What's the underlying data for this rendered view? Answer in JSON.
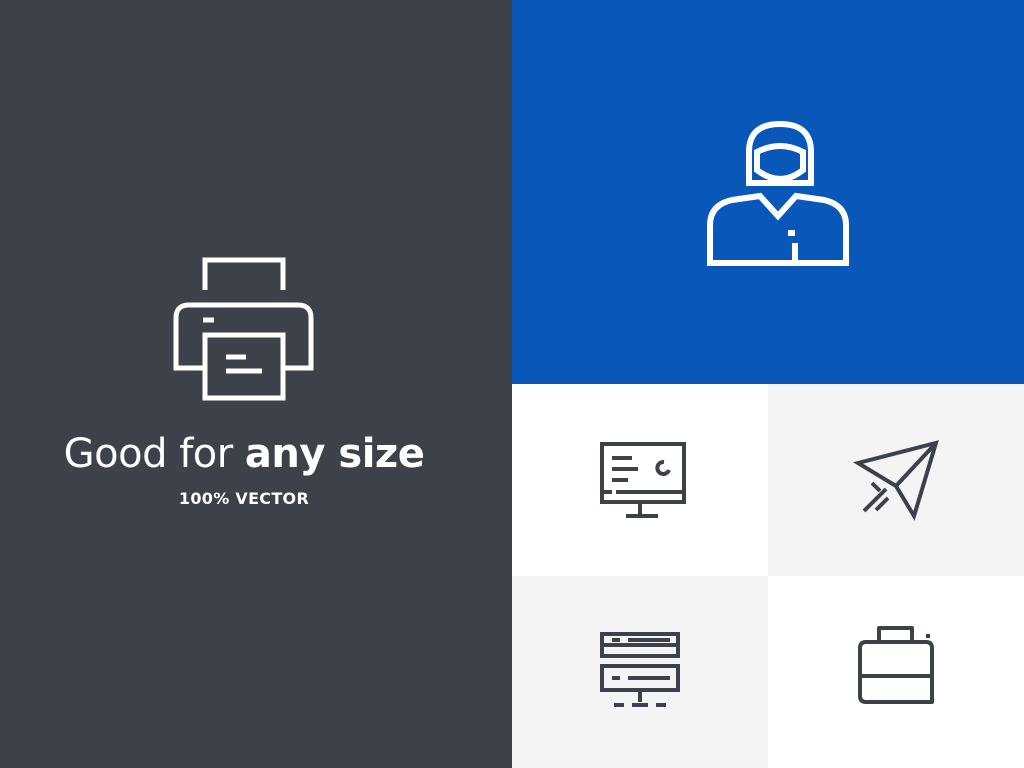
{
  "headline": {
    "regular": "Good for",
    "bold": "any size"
  },
  "subline": "100% VECTOR",
  "colors": {
    "left_panel": "#3c414a",
    "blue_panel": "#0957b9",
    "white_tile": "#ffffff",
    "light_tile": "#f4f4f4",
    "icon_dark": "#3c414a",
    "icon_light": "#ffffff"
  },
  "icons": {
    "hero": "printer-icon",
    "blue_tile": "user-headset-icon",
    "tile_1": "monitor-icon",
    "tile_2": "paper-plane-icon",
    "tile_3": "server-icon",
    "tile_4": "printer-icon"
  }
}
